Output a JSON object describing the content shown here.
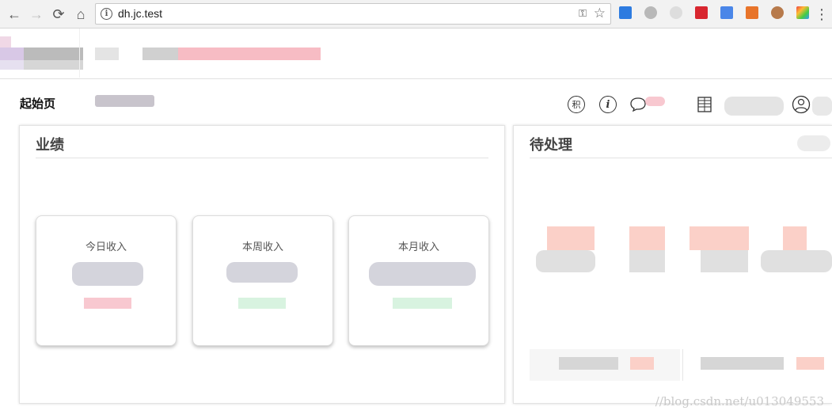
{
  "browser": {
    "url": "dh.jc.test"
  },
  "page": {
    "title": "起始页"
  },
  "toolbar": {
    "points_icon_text": "积",
    "info_icon_text": "i"
  },
  "performance": {
    "title": "业绩",
    "cards": [
      {
        "label": "今日收入"
      },
      {
        "label": "本周收入"
      },
      {
        "label": "本月收入"
      }
    ]
  },
  "pending": {
    "title": "待处理"
  },
  "watermark": "//blog.csdn.net/u013049553",
  "colors": {
    "blur_gray": "#c8c8d0",
    "blur_pink": "#f7c0c8",
    "blur_green": "#d8f3e0",
    "blur_salmon": "#fbd0c8"
  }
}
